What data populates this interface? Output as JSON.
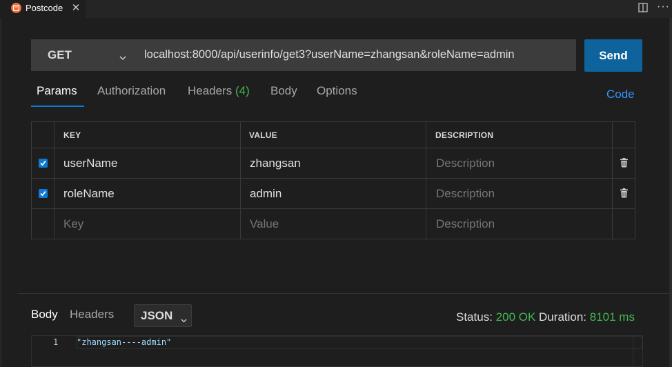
{
  "tab": {
    "title": "Postcode",
    "close_glyph": "✕"
  },
  "header_actions": {
    "split_icon": "split-editor-icon",
    "more_glyph": "···"
  },
  "request": {
    "method": "GET",
    "url": "localhost:8000/api/userinfo/get3?userName=zhangsan&roleName=admin",
    "send_label": "Send"
  },
  "request_tabs": {
    "params": "Params",
    "authorization": "Authorization",
    "headers": "Headers",
    "headers_count": "(4)",
    "body": "Body",
    "options": "Options",
    "code": "Code"
  },
  "params_table": {
    "columns": {
      "key": "KEY",
      "value": "VALUE",
      "description": "DESCRIPTION"
    },
    "rows": [
      {
        "checked": true,
        "key": "userName",
        "value": "zhangsan",
        "description": "Description"
      },
      {
        "checked": true,
        "key": "roleName",
        "value": "admin",
        "description": "Description"
      }
    ],
    "new_row": {
      "key": "Key",
      "value": "Value",
      "description": "Description"
    }
  },
  "response": {
    "body_tab": "Body",
    "headers_tab": "Headers",
    "format": "JSON",
    "status_label": "Status:",
    "status_value": "200 OK",
    "duration_label": "Duration:",
    "duration_value": "8101 ms",
    "line_number": "1",
    "content": "\"zhangsan----admin\""
  },
  "colors": {
    "accent": "#0e639c",
    "success": "#3fb950",
    "link": "#3794ff",
    "brand": "#f26b3a"
  }
}
